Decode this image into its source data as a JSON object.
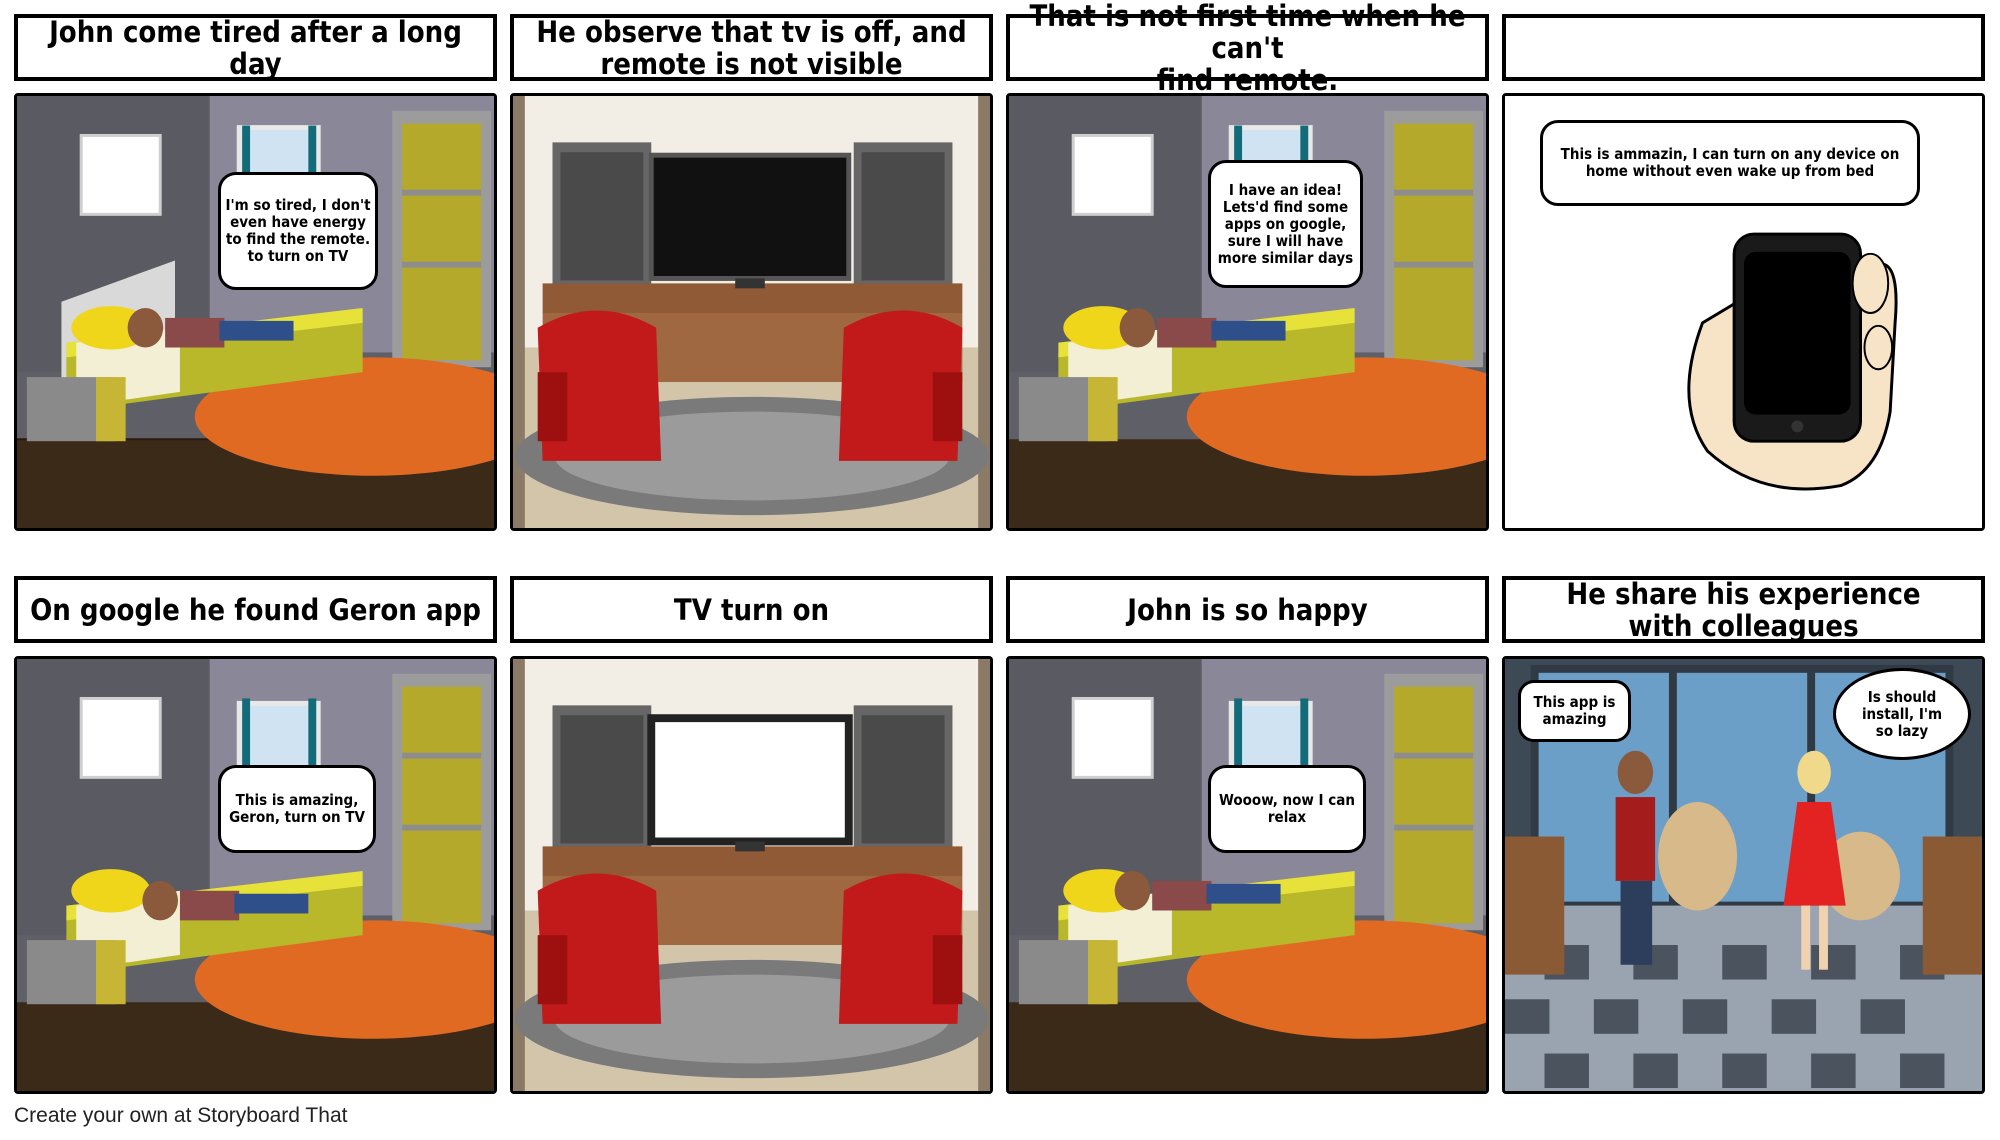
{
  "titles": [
    "John come tired after a long day",
    "He observe that tv is off, and\nremote is not visible",
    "That is not first time when he can't\nfind remote.",
    "",
    "On google he found Geron app",
    "TV turn on",
    "John is so happy",
    "He share his experience\nwith colleagues"
  ],
  "bubbles": {
    "p1": "I'm so tired, I don't\neven have energy\nto find the remote.\nto turn on TV",
    "p3": "I have an idea!\nLets'd find some\napps on google,\nsure I will have\nmore similar days",
    "p4": "This is ammazin, I can turn on any device on\nhome without even wake up from bed",
    "p5": "This is amazing,\nGeron, turn on TV",
    "p7": "Wooow, now I can\nrelax",
    "p8a": "This app is\namazing",
    "p8b": "Is should\ninstall, I'm\nso lazy"
  },
  "footer": "Create your own at Storyboard That"
}
